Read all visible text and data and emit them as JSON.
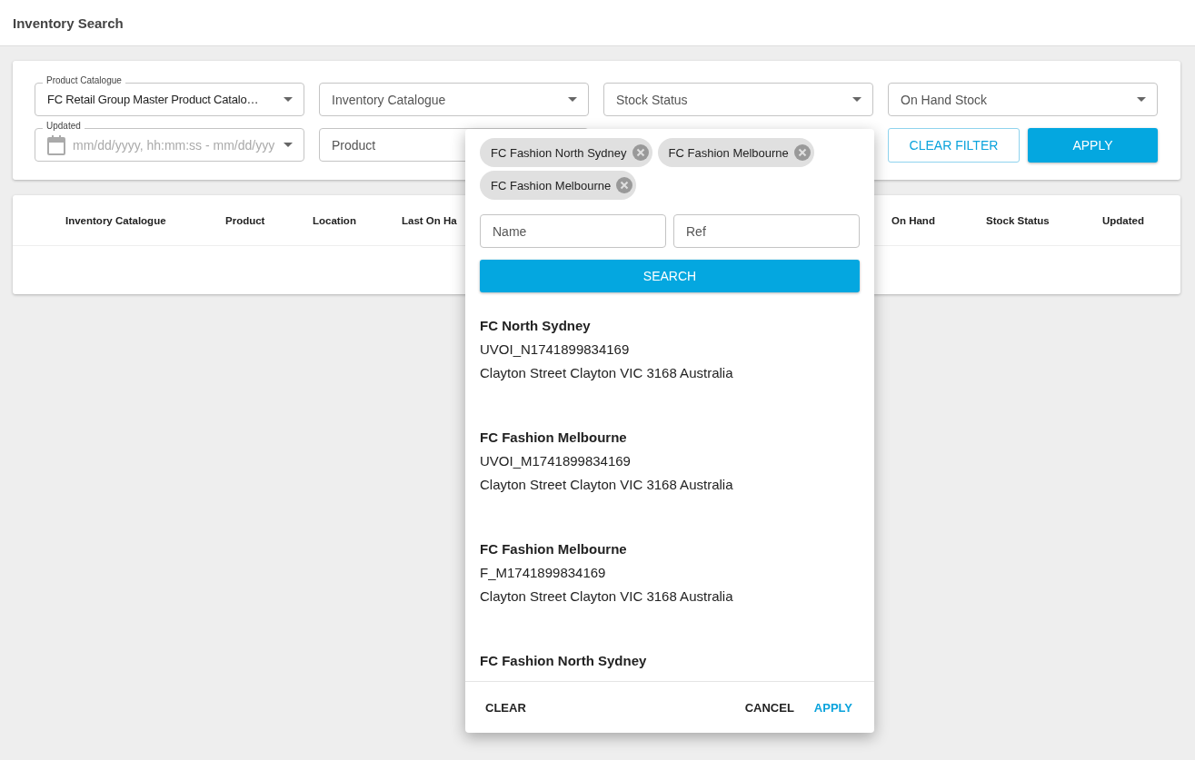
{
  "header": {
    "title": "Inventory Search"
  },
  "filters": [
    {
      "kind": "select",
      "label": "Product Catalogue",
      "value": "FC Retail Group Master Product Catalo…"
    },
    {
      "kind": "select",
      "placeholder": "Inventory Catalogue"
    },
    {
      "kind": "select",
      "placeholder": "Stock Status"
    },
    {
      "kind": "select",
      "placeholder": "On Hand Stock"
    },
    {
      "kind": "daterange",
      "label": "Updated",
      "placeholder": "mm/dd/yyyy, hh:mm:ss - mm/dd/yyy"
    },
    {
      "kind": "text",
      "placeholder": "Product"
    }
  ],
  "filter_buttons": [
    {
      "kind": "outline",
      "label": "CLEAR FILTER"
    },
    {
      "kind": "filled",
      "label": "APPLY"
    }
  ],
  "table": {
    "columns_left": [
      "Inventory Catalogue",
      "Product",
      "Location",
      "Last On Ha"
    ],
    "columns_right": [
      "On Hand",
      "Stock Status",
      "Updated"
    ]
  },
  "location_picker": {
    "chips": [
      "FC Fashion North Sydney",
      "FC Fashion Melbourne",
      "FC Fashion Melbourne"
    ],
    "fields": [
      {
        "placeholder": "Name"
      },
      {
        "placeholder": "Ref"
      }
    ],
    "search_button": "SEARCH",
    "results": [
      {
        "name": "FC North Sydney",
        "ref": "UVOI_N1741899834169",
        "address": "Clayton Street Clayton VIC 3168 Australia"
      },
      {
        "name": "FC Fashion Melbourne",
        "ref": "UVOI_M1741899834169",
        "address": "Clayton Street Clayton VIC 3168 Australia"
      },
      {
        "name": "FC Fashion Melbourne",
        "ref": "F_M1741899834169",
        "address": "Clayton Street Clayton VIC 3168 Australia"
      },
      {
        "name": "FC Fashion North Sydney"
      }
    ],
    "footer": {
      "clear": "CLEAR",
      "cancel": "CANCEL",
      "apply": "APPLY"
    }
  }
}
